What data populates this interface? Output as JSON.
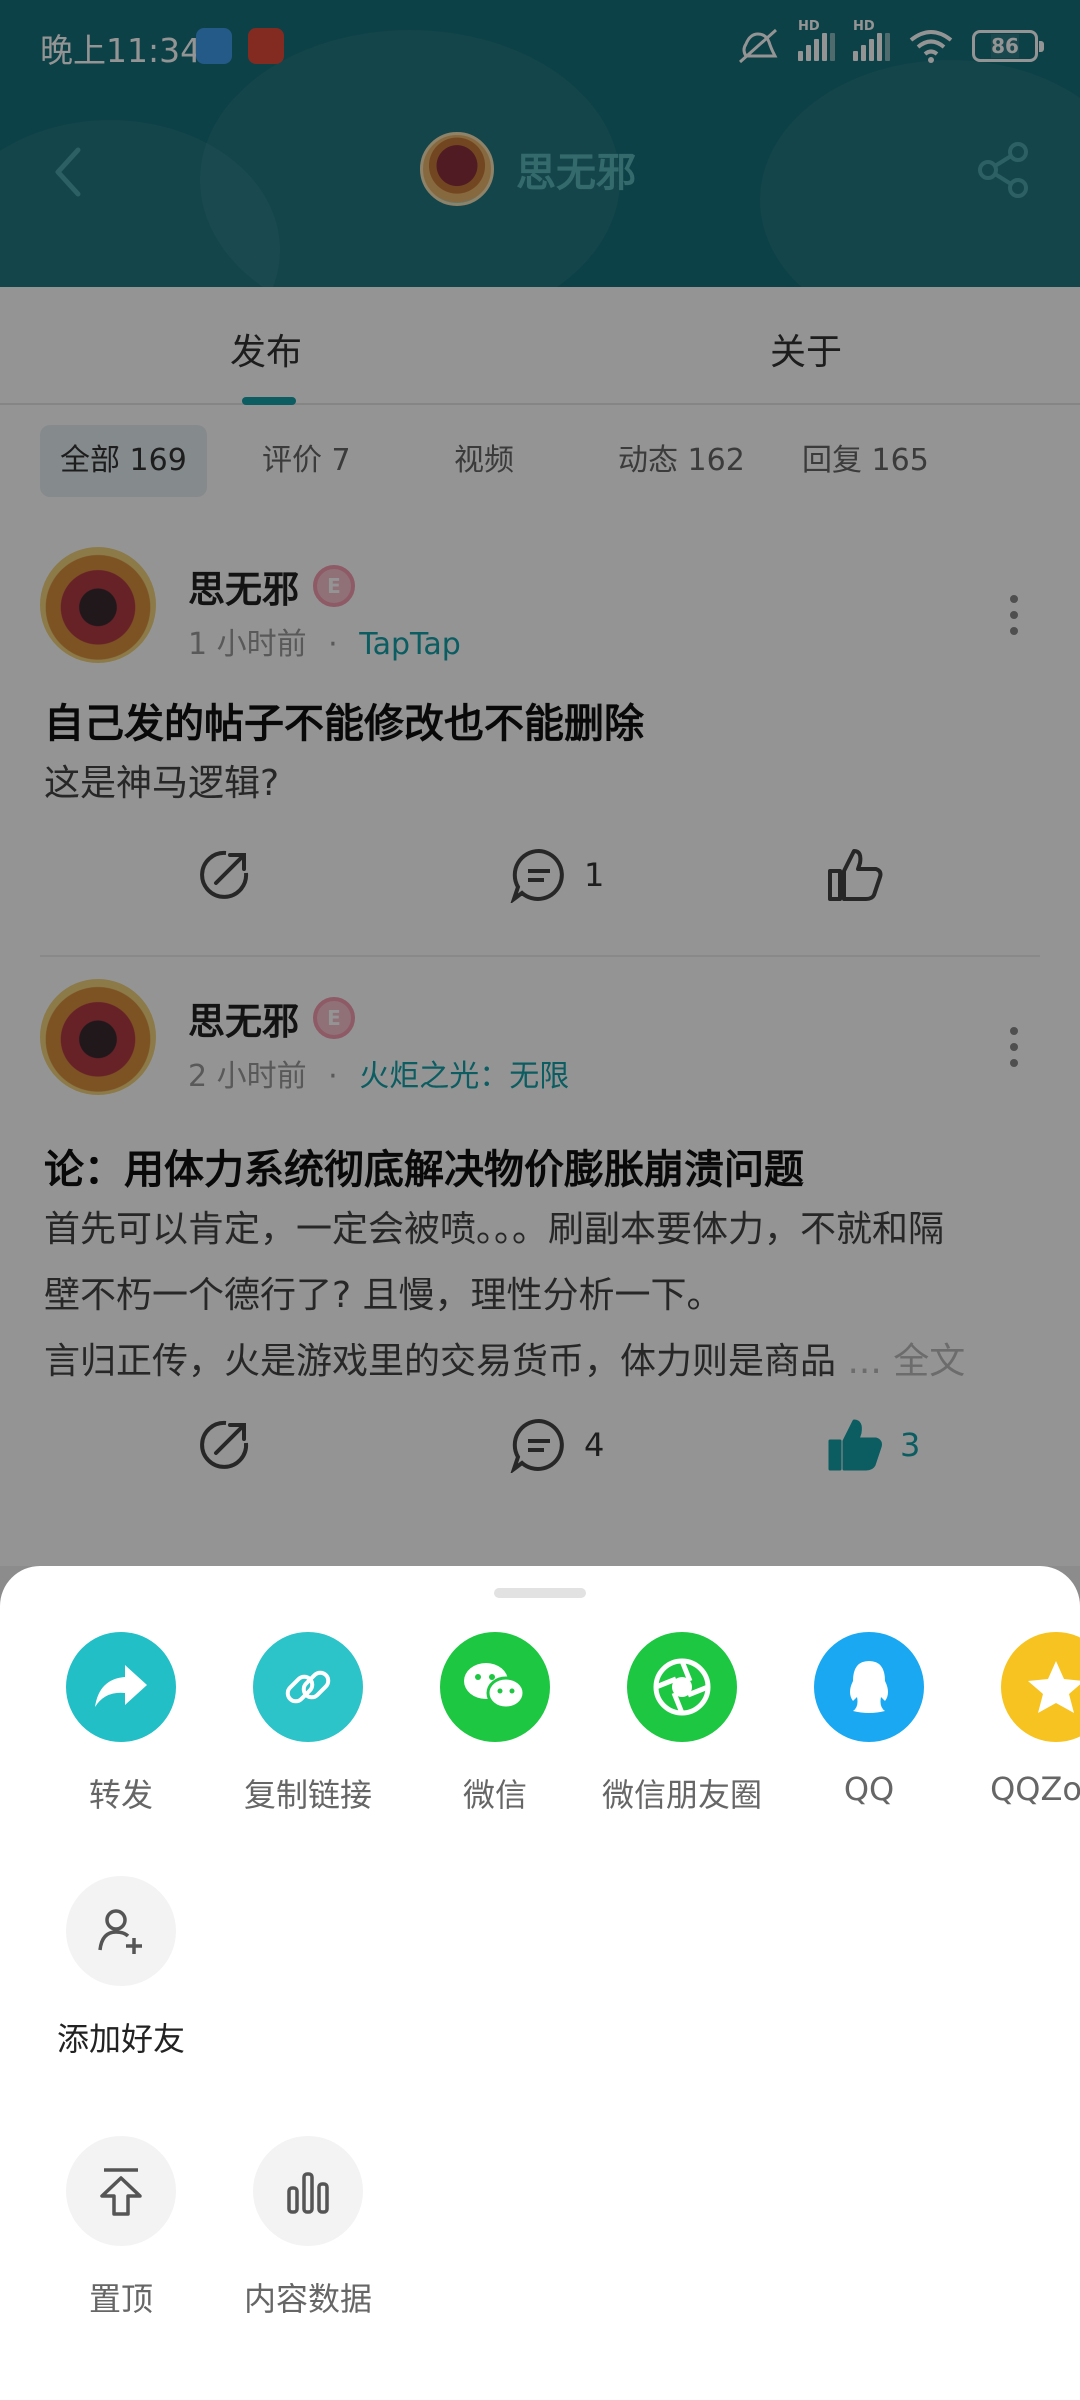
{
  "status_bar": {
    "time": "晚上11:34",
    "battery": "86",
    "signal_tag": "HD"
  },
  "nav": {
    "title": "思无邪"
  },
  "tabs": [
    {
      "label": "发布"
    },
    {
      "label": "关于"
    }
  ],
  "filters": [
    {
      "label": "全部 169"
    },
    {
      "label": "评价 7"
    },
    {
      "label": "视频"
    },
    {
      "label": "动态 162"
    },
    {
      "label": "回复 165"
    }
  ],
  "posts": [
    {
      "author": "思无邪",
      "time": "1 小时前",
      "dot": "·",
      "source": "TapTap",
      "title": "自己发的帖子不能修改也不能删除",
      "body": "这是神马逻辑?",
      "comment_count": "1",
      "like_count": ""
    },
    {
      "author": "思无邪",
      "time": "2 小时前",
      "dot": "·",
      "source": "火炬之光：无限",
      "title": "论：用体力系统彻底解决物价膨胀崩溃问题",
      "body_lines": [
        "首先可以肯定，一定会被喷。。。刷副本要体力，不就和隔",
        "壁不朽一个德行了? 且慢，理性分析一下。",
        "言归正传，火是游戏里的交易货币，体力则是商品"
      ],
      "more_link": " ... 全文",
      "comment_count": "4",
      "like_count": "3"
    }
  ],
  "share_sheet": {
    "row1": [
      {
        "label": "转发",
        "color": "#22bfc7"
      },
      {
        "label": "复制链接",
        "color": "#2cc3c9"
      },
      {
        "label": "微信",
        "color": "#1ec742"
      },
      {
        "label": "微信朋友圈",
        "color": "#1ec742"
      },
      {
        "label": "QQ",
        "color": "#1aa8f2"
      },
      {
        "label": "QQZone",
        "color": "#f7c320"
      }
    ],
    "row2": [
      {
        "label": "添加好友"
      }
    ],
    "row3": [
      {
        "label": "置顶"
      },
      {
        "label": "内容数据"
      }
    ]
  }
}
